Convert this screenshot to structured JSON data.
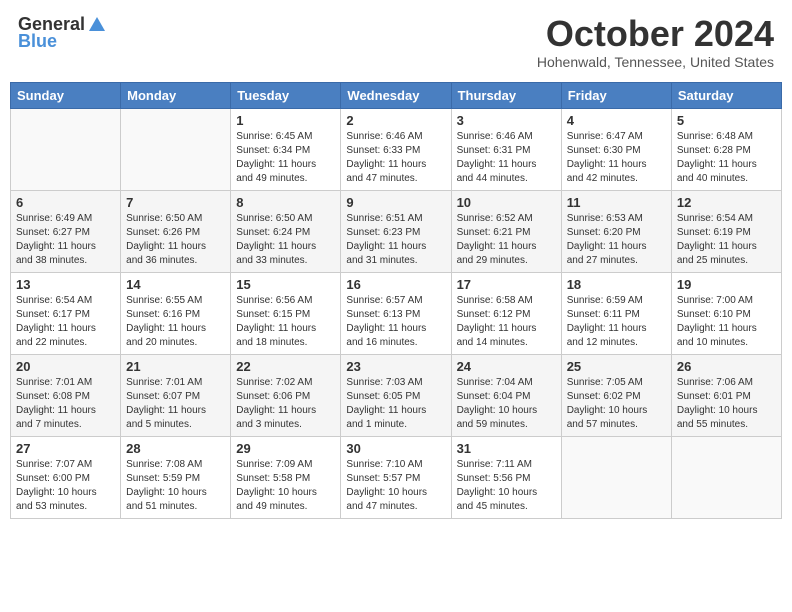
{
  "header": {
    "logo_general": "General",
    "logo_blue": "Blue",
    "month_title": "October 2024",
    "location": "Hohenwald, Tennessee, United States"
  },
  "days_of_week": [
    "Sunday",
    "Monday",
    "Tuesday",
    "Wednesday",
    "Thursday",
    "Friday",
    "Saturday"
  ],
  "weeks": [
    [
      {
        "day": "",
        "info": ""
      },
      {
        "day": "",
        "info": ""
      },
      {
        "day": "1",
        "info": "Sunrise: 6:45 AM\nSunset: 6:34 PM\nDaylight: 11 hours and 49 minutes."
      },
      {
        "day": "2",
        "info": "Sunrise: 6:46 AM\nSunset: 6:33 PM\nDaylight: 11 hours and 47 minutes."
      },
      {
        "day": "3",
        "info": "Sunrise: 6:46 AM\nSunset: 6:31 PM\nDaylight: 11 hours and 44 minutes."
      },
      {
        "day": "4",
        "info": "Sunrise: 6:47 AM\nSunset: 6:30 PM\nDaylight: 11 hours and 42 minutes."
      },
      {
        "day": "5",
        "info": "Sunrise: 6:48 AM\nSunset: 6:28 PM\nDaylight: 11 hours and 40 minutes."
      }
    ],
    [
      {
        "day": "6",
        "info": "Sunrise: 6:49 AM\nSunset: 6:27 PM\nDaylight: 11 hours and 38 minutes."
      },
      {
        "day": "7",
        "info": "Sunrise: 6:50 AM\nSunset: 6:26 PM\nDaylight: 11 hours and 36 minutes."
      },
      {
        "day": "8",
        "info": "Sunrise: 6:50 AM\nSunset: 6:24 PM\nDaylight: 11 hours and 33 minutes."
      },
      {
        "day": "9",
        "info": "Sunrise: 6:51 AM\nSunset: 6:23 PM\nDaylight: 11 hours and 31 minutes."
      },
      {
        "day": "10",
        "info": "Sunrise: 6:52 AM\nSunset: 6:21 PM\nDaylight: 11 hours and 29 minutes."
      },
      {
        "day": "11",
        "info": "Sunrise: 6:53 AM\nSunset: 6:20 PM\nDaylight: 11 hours and 27 minutes."
      },
      {
        "day": "12",
        "info": "Sunrise: 6:54 AM\nSunset: 6:19 PM\nDaylight: 11 hours and 25 minutes."
      }
    ],
    [
      {
        "day": "13",
        "info": "Sunrise: 6:54 AM\nSunset: 6:17 PM\nDaylight: 11 hours and 22 minutes."
      },
      {
        "day": "14",
        "info": "Sunrise: 6:55 AM\nSunset: 6:16 PM\nDaylight: 11 hours and 20 minutes."
      },
      {
        "day": "15",
        "info": "Sunrise: 6:56 AM\nSunset: 6:15 PM\nDaylight: 11 hours and 18 minutes."
      },
      {
        "day": "16",
        "info": "Sunrise: 6:57 AM\nSunset: 6:13 PM\nDaylight: 11 hours and 16 minutes."
      },
      {
        "day": "17",
        "info": "Sunrise: 6:58 AM\nSunset: 6:12 PM\nDaylight: 11 hours and 14 minutes."
      },
      {
        "day": "18",
        "info": "Sunrise: 6:59 AM\nSunset: 6:11 PM\nDaylight: 11 hours and 12 minutes."
      },
      {
        "day": "19",
        "info": "Sunrise: 7:00 AM\nSunset: 6:10 PM\nDaylight: 11 hours and 10 minutes."
      }
    ],
    [
      {
        "day": "20",
        "info": "Sunrise: 7:01 AM\nSunset: 6:08 PM\nDaylight: 11 hours and 7 minutes."
      },
      {
        "day": "21",
        "info": "Sunrise: 7:01 AM\nSunset: 6:07 PM\nDaylight: 11 hours and 5 minutes."
      },
      {
        "day": "22",
        "info": "Sunrise: 7:02 AM\nSunset: 6:06 PM\nDaylight: 11 hours and 3 minutes."
      },
      {
        "day": "23",
        "info": "Sunrise: 7:03 AM\nSunset: 6:05 PM\nDaylight: 11 hours and 1 minute."
      },
      {
        "day": "24",
        "info": "Sunrise: 7:04 AM\nSunset: 6:04 PM\nDaylight: 10 hours and 59 minutes."
      },
      {
        "day": "25",
        "info": "Sunrise: 7:05 AM\nSunset: 6:02 PM\nDaylight: 10 hours and 57 minutes."
      },
      {
        "day": "26",
        "info": "Sunrise: 7:06 AM\nSunset: 6:01 PM\nDaylight: 10 hours and 55 minutes."
      }
    ],
    [
      {
        "day": "27",
        "info": "Sunrise: 7:07 AM\nSunset: 6:00 PM\nDaylight: 10 hours and 53 minutes."
      },
      {
        "day": "28",
        "info": "Sunrise: 7:08 AM\nSunset: 5:59 PM\nDaylight: 10 hours and 51 minutes."
      },
      {
        "day": "29",
        "info": "Sunrise: 7:09 AM\nSunset: 5:58 PM\nDaylight: 10 hours and 49 minutes."
      },
      {
        "day": "30",
        "info": "Sunrise: 7:10 AM\nSunset: 5:57 PM\nDaylight: 10 hours and 47 minutes."
      },
      {
        "day": "31",
        "info": "Sunrise: 7:11 AM\nSunset: 5:56 PM\nDaylight: 10 hours and 45 minutes."
      },
      {
        "day": "",
        "info": ""
      },
      {
        "day": "",
        "info": ""
      }
    ]
  ]
}
